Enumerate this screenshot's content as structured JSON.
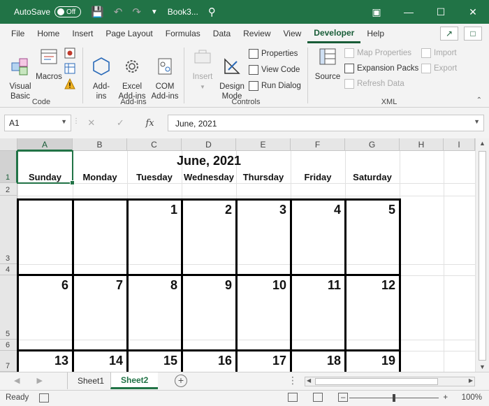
{
  "titlebar": {
    "autosave_label": "AutoSave",
    "autosave_state": "Off",
    "doc_title": "Book3...",
    "search_icon": "search-icon"
  },
  "tabs": [
    "File",
    "Home",
    "Insert",
    "Page Layout",
    "Formulas",
    "Data",
    "Review",
    "View",
    "Developer",
    "Help"
  ],
  "active_tab": "Developer",
  "ribbon": {
    "code": {
      "label": "Code",
      "visual_basic": "Visual\nBasic",
      "macros": "Macros"
    },
    "addins": {
      "label": "Add-ins",
      "addins": "Add-\nins",
      "excel_addins": "Excel\nAdd-ins",
      "com_addins": "COM\nAdd-ins"
    },
    "controls": {
      "label": "Controls",
      "insert": "Insert",
      "design_mode": "Design\nMode",
      "properties": "Properties",
      "view_code": "View Code",
      "run_dialog": "Run Dialog"
    },
    "xml": {
      "label": "XML",
      "source": "Source",
      "map_properties": "Map Properties",
      "expansion_packs": "Expansion Packs",
      "refresh_data": "Refresh Data",
      "import": "Import",
      "export": "Export"
    }
  },
  "formula_bar": {
    "name_box": "A1",
    "fx": "fx",
    "value": "June, 2021"
  },
  "grid": {
    "columns": [
      "A",
      "B",
      "C",
      "D",
      "E",
      "F",
      "G",
      "H",
      "I"
    ],
    "rows": [
      "1",
      "2",
      "3",
      "4",
      "5",
      "6",
      "7"
    ],
    "selected_cell": "A1"
  },
  "calendar": {
    "title": "June, 2021",
    "day_names": [
      "Sunday",
      "Monday",
      "Tuesday",
      "Wednesday",
      "Thursday",
      "Friday",
      "Saturday"
    ],
    "weeks": [
      [
        "",
        "",
        "1",
        "2",
        "3",
        "4",
        "5"
      ],
      [
        "6",
        "7",
        "8",
        "9",
        "10",
        "11",
        "12"
      ],
      [
        "13",
        "14",
        "15",
        "16",
        "17",
        "18",
        "19"
      ]
    ]
  },
  "sheets": [
    "Sheet1",
    "Sheet2"
  ],
  "active_sheet": "Sheet2",
  "status": {
    "ready": "Ready",
    "zoom": "100%",
    "zoom_level": 1.0
  },
  "colors": {
    "accent": "#217346",
    "accent_dark": "#185c37"
  }
}
